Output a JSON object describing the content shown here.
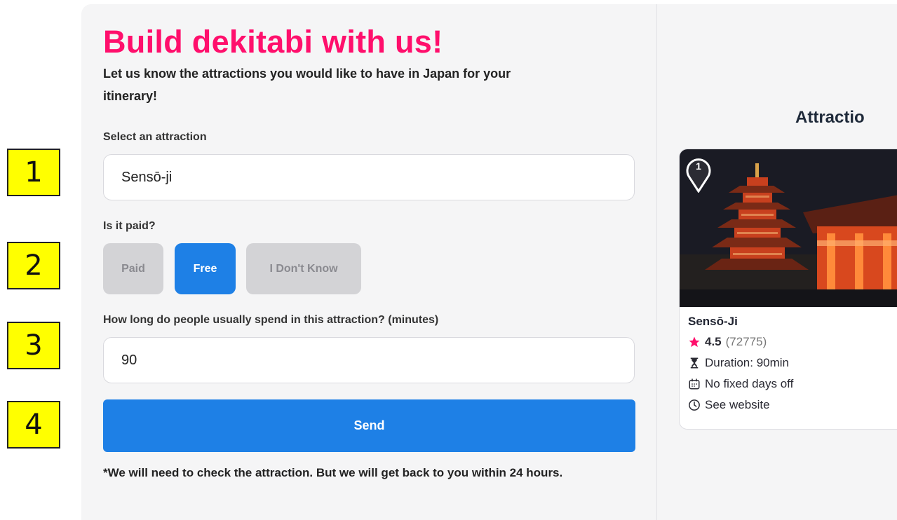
{
  "step_markers": [
    "1",
    "2",
    "3",
    "4"
  ],
  "form": {
    "title": "Build dekitabi with us!",
    "subtitle": "Let us know the attractions you would like to have in Japan for your itinerary!",
    "attraction_label": "Select an attraction",
    "attraction_value": "Sensō-ji",
    "paid_label": "Is it paid?",
    "paid_options": [
      "Paid",
      "Free",
      "I Don't Know"
    ],
    "paid_selected": "Free",
    "duration_label": "How long do people usually spend in this attraction? (minutes)",
    "duration_value": "90",
    "send_label": "Send",
    "footnote": "*We will need to check the attraction. But we will get back to you within 24 hours."
  },
  "preview": {
    "heading": "Attractio",
    "card": {
      "pin_number": "1",
      "name": "Sensō-Ji",
      "rating": "4.5",
      "review_count": "(72775)",
      "duration": "Duration: 90min",
      "days_off": "No fixed days off",
      "hours": "See website"
    }
  },
  "colors": {
    "brand_pink": "#ff0f6c",
    "primary_blue": "#1e80e6",
    "option_inactive": "#d3d3d6",
    "marker_yellow": "#ffff00",
    "star": "#ff0f6c"
  },
  "icons": [
    "star-icon",
    "hourglass-icon",
    "calendar-icon",
    "clock-icon",
    "map-pin-icon"
  ]
}
